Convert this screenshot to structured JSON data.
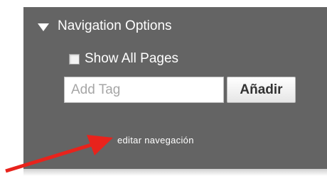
{
  "nav": {
    "title": "Navigation Options",
    "collapse_icon": "triangle-down-icon"
  },
  "show_all": {
    "label": "Show All Pages",
    "checked": false
  },
  "tag": {
    "placeholder": "Add Tag",
    "value": "",
    "button_label": "Añadir"
  },
  "edit_link": "editar navegación",
  "annotation": {
    "icon": "arrow-icon",
    "color": "#e8231c"
  },
  "colors": {
    "panel": "#646464",
    "text": "#ffffff"
  }
}
